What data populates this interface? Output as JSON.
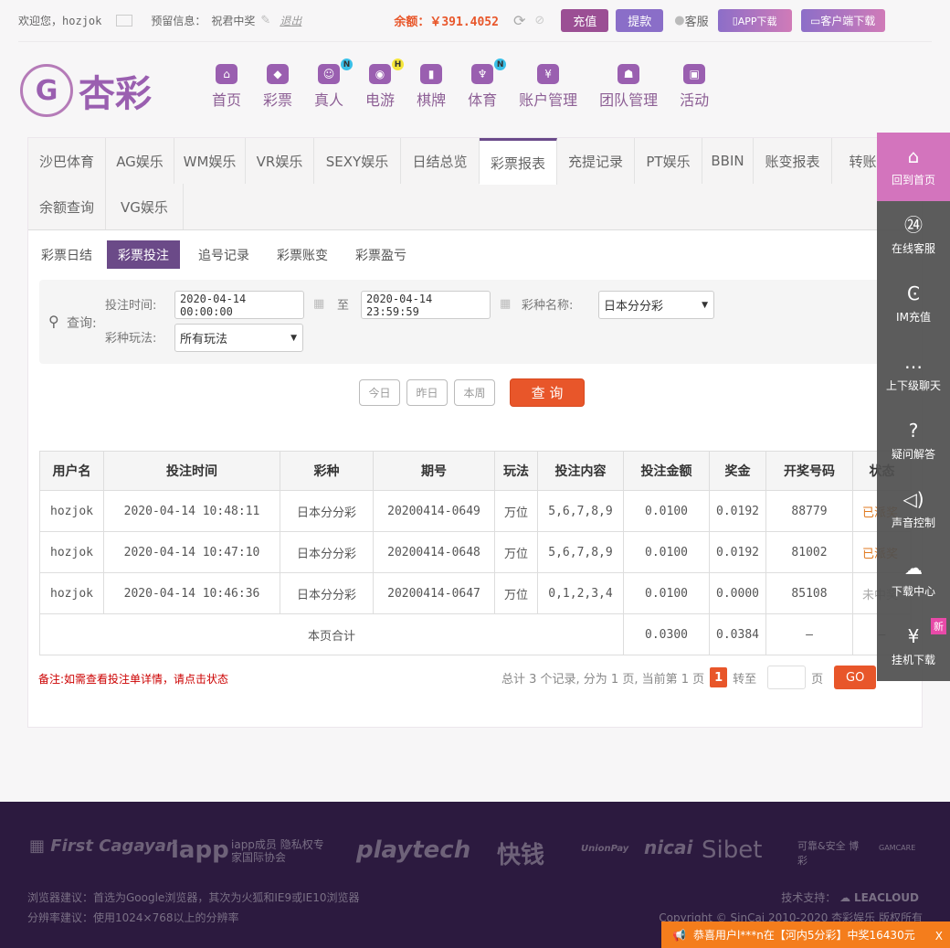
{
  "topbar": {
    "welcome": "欢迎您，",
    "username": "hozjok",
    "reserved_label": "预留信息：",
    "reserved_value": "祝君中奖",
    "logout": "退出",
    "balance_label": "余额：",
    "balance_value": "￥391.4052",
    "deposit": "充值",
    "withdraw": "提款",
    "service": "客服",
    "app_download": "APP下载",
    "client_download": "客户端下载"
  },
  "logo": {
    "text": "杏彩"
  },
  "nav": [
    {
      "label": "首页"
    },
    {
      "label": "彩票"
    },
    {
      "label": "真人",
      "badge": "N"
    },
    {
      "label": "电游",
      "badge": "H"
    },
    {
      "label": "棋牌"
    },
    {
      "label": "体育",
      "badge": "N"
    },
    {
      "label": "账户管理"
    },
    {
      "label": "团队管理"
    },
    {
      "label": "活动"
    }
  ],
  "tabs": [
    "沙巴体育",
    "AG娱乐",
    "WM娱乐",
    "VR娱乐",
    "SEXY娱乐",
    "日结总览",
    "彩票报表",
    "充提记录",
    "PT娱乐",
    "BBIN",
    "账变报表",
    "转账报表",
    "余额查询",
    "VG娱乐"
  ],
  "subtabs": [
    "彩票日结",
    "彩票投注",
    "追号记录",
    "彩票账变",
    "彩票盈亏"
  ],
  "filter": {
    "query_label": "查询:",
    "bet_time_label": "投注时间:",
    "start": "2020-04-14 00:00:00",
    "to": "至",
    "end": "2020-04-14 23:59:59",
    "lottery_label": "彩种名称:",
    "lottery_value": "日本分分彩",
    "play_label": "彩种玩法:",
    "play_value": "所有玩法",
    "today": "今日",
    "yesterday": "昨日",
    "week": "本周",
    "search": "查 询"
  },
  "table": {
    "headers": [
      "用户名",
      "投注时间",
      "彩种",
      "期号",
      "玩法",
      "投注内容",
      "投注金额",
      "奖金",
      "开奖号码",
      "状态"
    ],
    "rows": [
      [
        "hozjok",
        "2020-04-14 10:48:11",
        "日本分分彩",
        "20200414-0649",
        "万位",
        "5,6,7,8,9",
        "0.0100",
        "0.0192",
        "88779",
        "已派奖"
      ],
      [
        "hozjok",
        "2020-04-14 10:47:10",
        "日本分分彩",
        "20200414-0648",
        "万位",
        "5,6,7,8,9",
        "0.0100",
        "0.0192",
        "81002",
        "已派奖"
      ],
      [
        "hozjok",
        "2020-04-14 10:46:36",
        "日本分分彩",
        "20200414-0647",
        "万位",
        "0,1,2,3,4",
        "0.0100",
        "0.0000",
        "85108",
        "未中奖"
      ]
    ],
    "total": {
      "label": "本页合计",
      "amount": "0.0300",
      "prize": "0.0384",
      "number": "—",
      "status": "—"
    }
  },
  "note": "备注:如需查看投注单详情，请点击状态",
  "pager": {
    "summary": "总计 3 个记录, 分为 1 页, 当前第 1 页",
    "current": "1",
    "goto": "转至",
    "page": "页",
    "go": "GO"
  },
  "side": [
    {
      "label": "回到首页",
      "icon": "home-icon"
    },
    {
      "label": "在线客服",
      "icon": "headset-24-icon"
    },
    {
      "label": "IM充值",
      "icon": "im-icon"
    },
    {
      "label": "上下级聊天",
      "icon": "chat-icon"
    },
    {
      "label": "疑问解答",
      "icon": "question-icon"
    },
    {
      "label": "声音控制",
      "icon": "speaker-icon"
    },
    {
      "label": "下载中心",
      "icon": "cloud-download-icon"
    },
    {
      "label": "挂机下载",
      "icon": "money-bag-icon",
      "badge": "新"
    }
  ],
  "footer": {
    "logos": [
      "First Cagayan",
      "iapp",
      "iapp成员 隐私权专家国际协会",
      "playtech",
      "快钱",
      "UnionPay",
      "nicai",
      "Sibet",
      "可靠&安全 博彩",
      "GAMCARE"
    ],
    "browser": "浏览器建议：首选为Google浏览器，其次为火狐和IE9或IE10浏览器",
    "resolution": "分辨率建议：使用1024×768以上的分辨率",
    "tech": "技术支持：",
    "tech_brand": "LEACLOUD",
    "copyright": "Copyright © SinCai 2010-2020 杏彩娱乐 版权所有"
  },
  "toast": {
    "text": "恭喜用户l***n在【河内5分彩】中奖16430元",
    "close": "X"
  },
  "colors": {
    "brand": "#8c4a8f",
    "accent": "#e8562a",
    "won": "#e07a20",
    "footer": "#2c1a3f"
  }
}
